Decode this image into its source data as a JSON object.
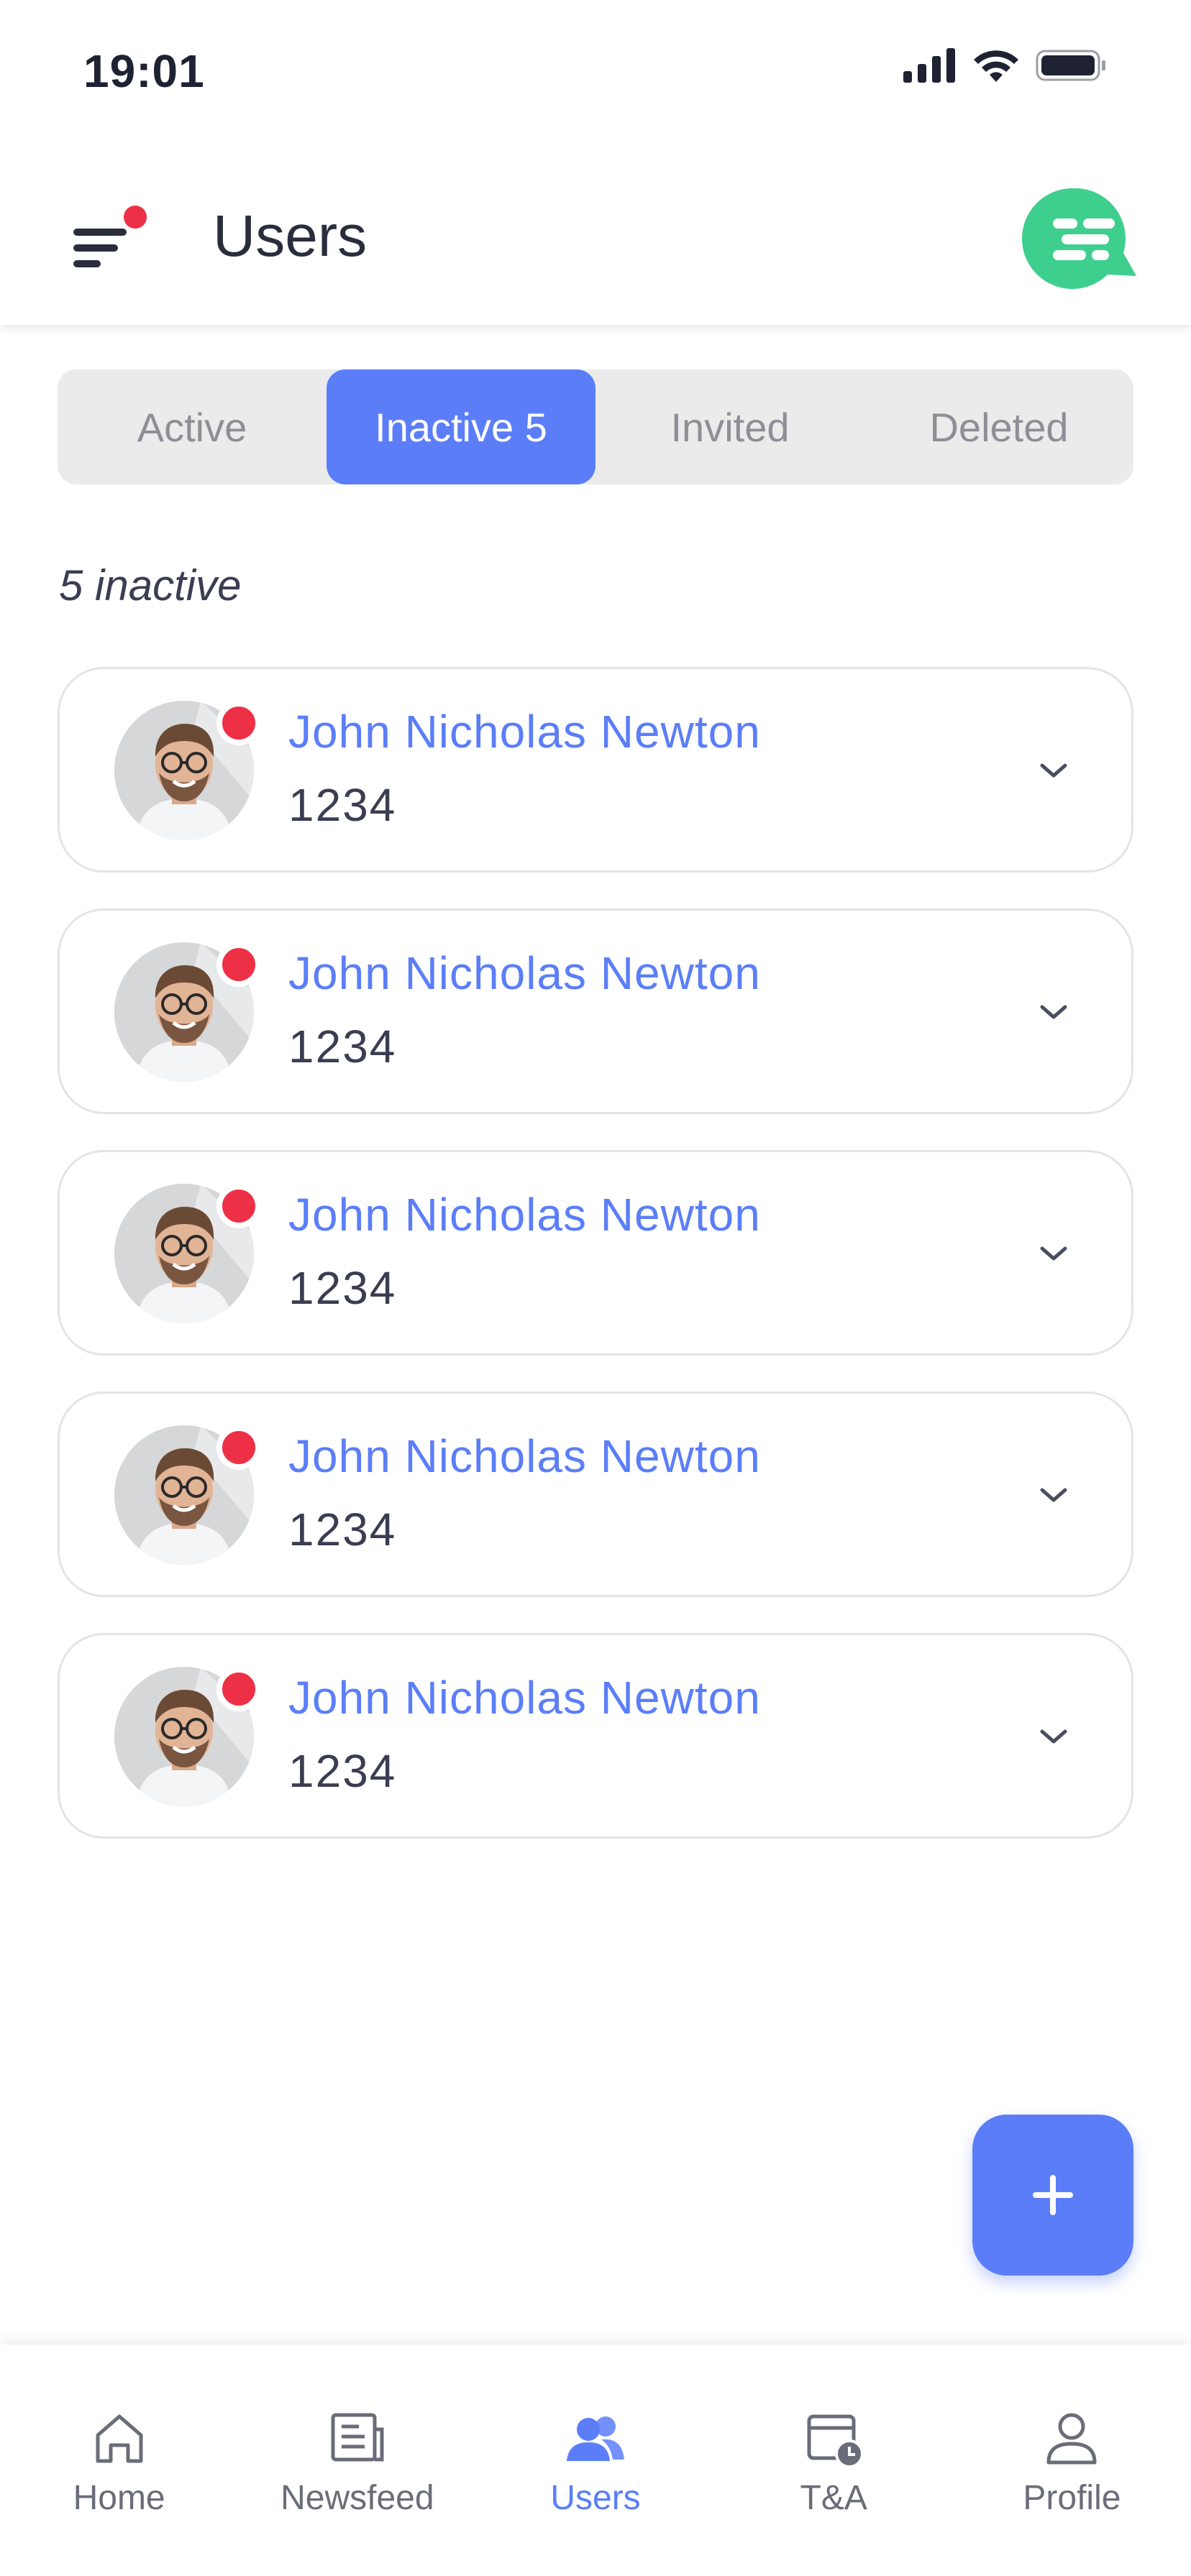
{
  "status_bar": {
    "time": "19:01"
  },
  "header": {
    "title": "Users"
  },
  "tabs": [
    {
      "label": "Active",
      "active": false
    },
    {
      "label": "Inactive 5",
      "active": true
    },
    {
      "label": "Invited",
      "active": false
    },
    {
      "label": "Deleted",
      "active": false
    }
  ],
  "summary": "5 inactive",
  "users": [
    {
      "name": "John Nicholas Newton",
      "id": "1234"
    },
    {
      "name": "John Nicholas Newton",
      "id": "1234"
    },
    {
      "name": "John Nicholas Newton",
      "id": "1234"
    },
    {
      "name": "John Nicholas Newton",
      "id": "1234"
    },
    {
      "name": "John Nicholas Newton",
      "id": "1234"
    }
  ],
  "bottom_nav": [
    {
      "label": "Home",
      "icon": "home-icon",
      "active": false
    },
    {
      "label": "Newsfeed",
      "icon": "newsfeed-icon",
      "active": false
    },
    {
      "label": "Users",
      "icon": "users-icon",
      "active": true
    },
    {
      "label": "T&A",
      "icon": "time-attendance-icon",
      "active": false
    },
    {
      "label": "Profile",
      "icon": "profile-icon",
      "active": false
    }
  ],
  "colors": {
    "accent": "#5b7ef8",
    "status_inactive": "#ee3046",
    "chat_brand": "#3ecf8e"
  }
}
